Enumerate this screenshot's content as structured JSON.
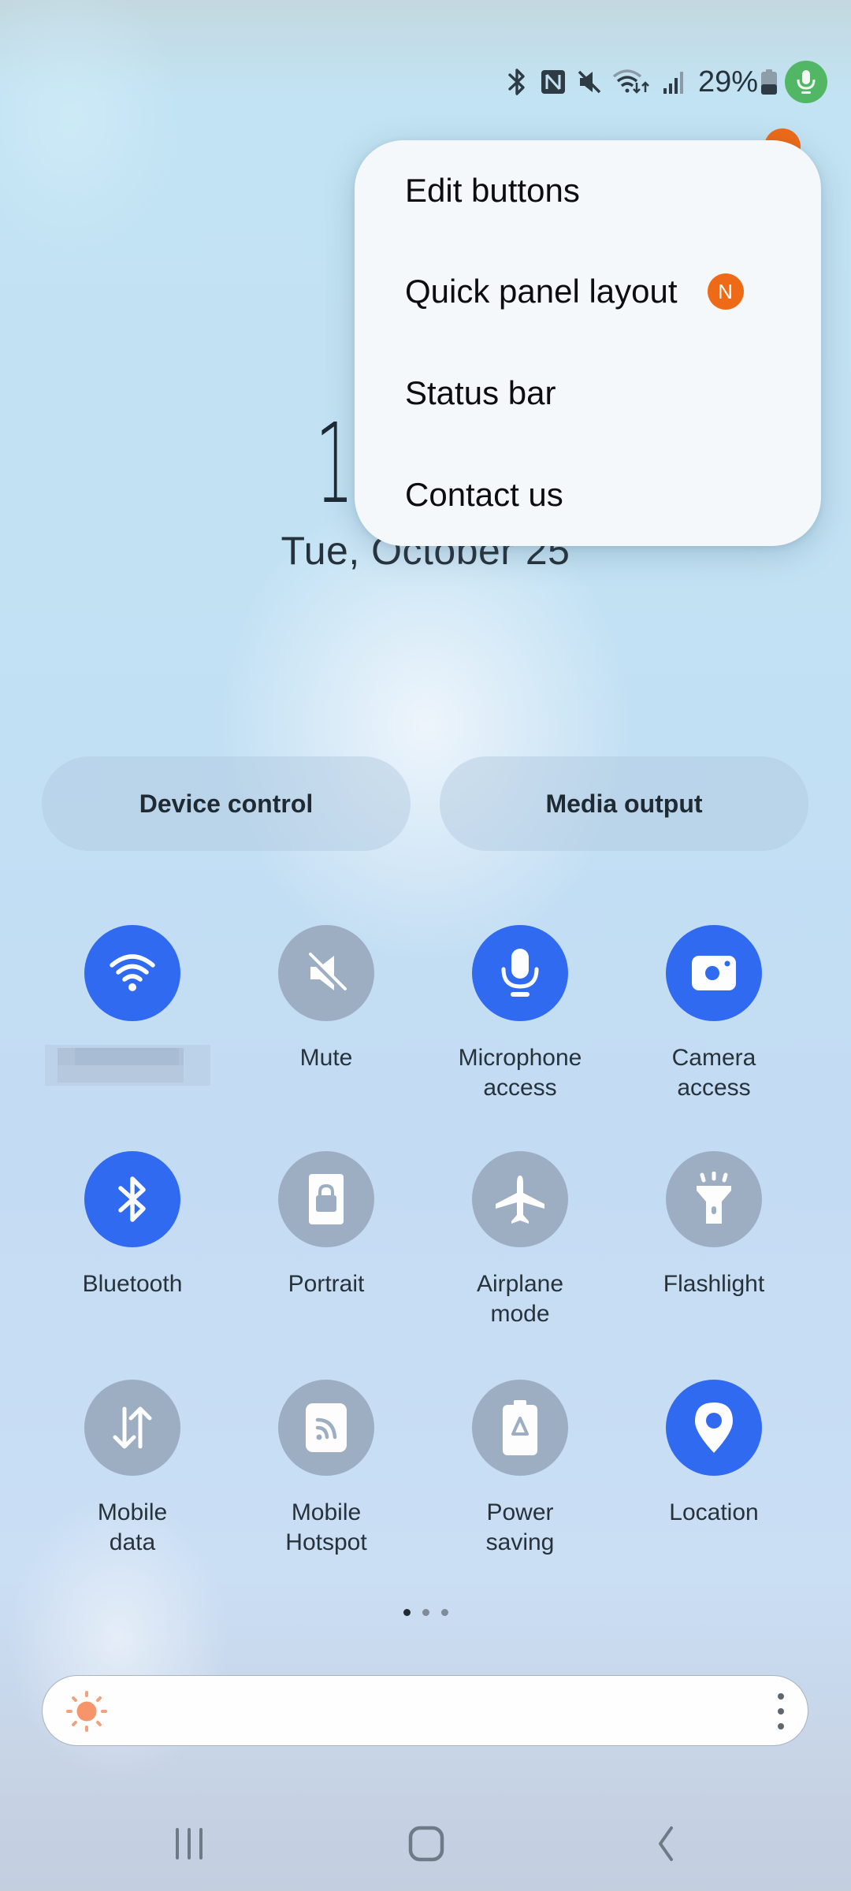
{
  "status_bar": {
    "icons": [
      "bluetooth-icon",
      "nfc-icon",
      "mute-icon",
      "wifi-icon",
      "signal-icon",
      "battery-icon",
      "microphone-in-use-icon"
    ],
    "battery_percent": "29%",
    "battery_level": 0.29
  },
  "clock": {
    "time_visible": "1",
    "date": "Tue, October 25"
  },
  "menu": {
    "items": [
      {
        "label": "Edit buttons"
      },
      {
        "label": "Quick panel layout",
        "badge": "N"
      },
      {
        "label": "Status bar"
      },
      {
        "label": "Contact us"
      }
    ]
  },
  "panel_buttons": {
    "device_control": "Device control",
    "media_output": "Media output"
  },
  "tiles": [
    {
      "label": "",
      "label_redacted": true,
      "icon": "wifi-icon",
      "state": "on"
    },
    {
      "label": "Mute",
      "icon": "mute-icon",
      "state": "off"
    },
    {
      "label": "Microphone access",
      "icon": "microphone-icon",
      "state": "on"
    },
    {
      "label": "Camera access",
      "icon": "camera-icon",
      "state": "on"
    },
    {
      "label": "Bluetooth",
      "icon": "bluetooth-icon",
      "state": "on"
    },
    {
      "label": "Portrait",
      "icon": "portrait-lock-icon",
      "state": "off"
    },
    {
      "label": "Airplane mode",
      "icon": "airplane-icon",
      "state": "off"
    },
    {
      "label": "Flashlight",
      "icon": "flashlight-icon",
      "state": "off"
    },
    {
      "label": "Mobile data",
      "icon": "mobile-data-icon",
      "state": "off"
    },
    {
      "label": "Mobile Hotspot",
      "icon": "hotspot-icon",
      "state": "off"
    },
    {
      "label": "Power saving",
      "icon": "power-saving-icon",
      "state": "off"
    },
    {
      "label": "Location",
      "icon": "location-icon",
      "state": "on"
    }
  ],
  "tile_labels_split": [
    [
      "",
      ""
    ],
    [
      "Mute",
      ""
    ],
    [
      "Microphone",
      "access"
    ],
    [
      "Camera",
      "access"
    ],
    [
      "Bluetooth",
      ""
    ],
    [
      "Portrait",
      ""
    ],
    [
      "Airplane",
      "mode"
    ],
    [
      "Flashlight",
      ""
    ],
    [
      "Mobile",
      "data"
    ],
    [
      "Mobile",
      "Hotspot"
    ],
    [
      "Power",
      "saving"
    ],
    [
      "Location",
      ""
    ]
  ],
  "pager": {
    "pages": 3,
    "current": 1
  },
  "brightness": {
    "level": 0.0
  },
  "navigation": [
    "recents-button",
    "home-button",
    "back-button"
  ],
  "colors": {
    "tile_on": "#2f6af0",
    "tile_off": "#9daec2",
    "badge": "#ef6a16",
    "mic_indicator": "#52b764",
    "sun": "#f7956a"
  }
}
